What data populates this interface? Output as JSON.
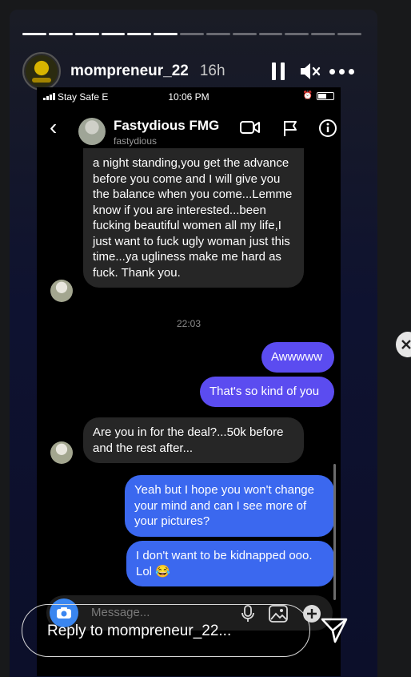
{
  "story": {
    "username": "mompreneur_22",
    "time_ago": "16h",
    "progress_segments": 13,
    "progress_done": 6,
    "reply_placeholder": "Reply to mompreneur_22..."
  },
  "statusbar": {
    "carrier": "Stay Safe  E",
    "time": "10:06 PM"
  },
  "chat": {
    "name": "Fastydious FMG",
    "handle": "fastydious",
    "timestamp": "22:03",
    "messages": [
      {
        "from": "them",
        "text": "a night standing,you get the advance before you come and I will give you the balance when you come...Lemme know if you are interested...been fucking beautiful women all my life,I just want to fuck ugly woman just this time...ya ugliness make me hard as fuck. Thank you."
      },
      {
        "from": "me",
        "text": "Awwwww"
      },
      {
        "from": "me",
        "text": "That's so kind of you"
      },
      {
        "from": "them",
        "text": "Are you in for the deal?...50k before and the rest after..."
      },
      {
        "from": "me",
        "text": "Yeah but I hope you won't change your mind and can I see more of your pictures?"
      },
      {
        "from": "me",
        "text": "I don't want to be kidnapped ooo. Lol 😂"
      }
    ],
    "composer_placeholder": "Message..."
  },
  "colors": {
    "sent_purple": "#5b4cf0",
    "sent_blue": "#3b68ef",
    "received": "#262626",
    "story_bg": "#0e1230"
  },
  "icons": [
    "pause-icon",
    "mute-icon",
    "more-icon",
    "back-icon",
    "video-call-icon",
    "flag-icon",
    "info-icon",
    "camera-icon",
    "microphone-icon",
    "gallery-icon",
    "add-icon",
    "send-icon",
    "next-story-icon"
  ]
}
